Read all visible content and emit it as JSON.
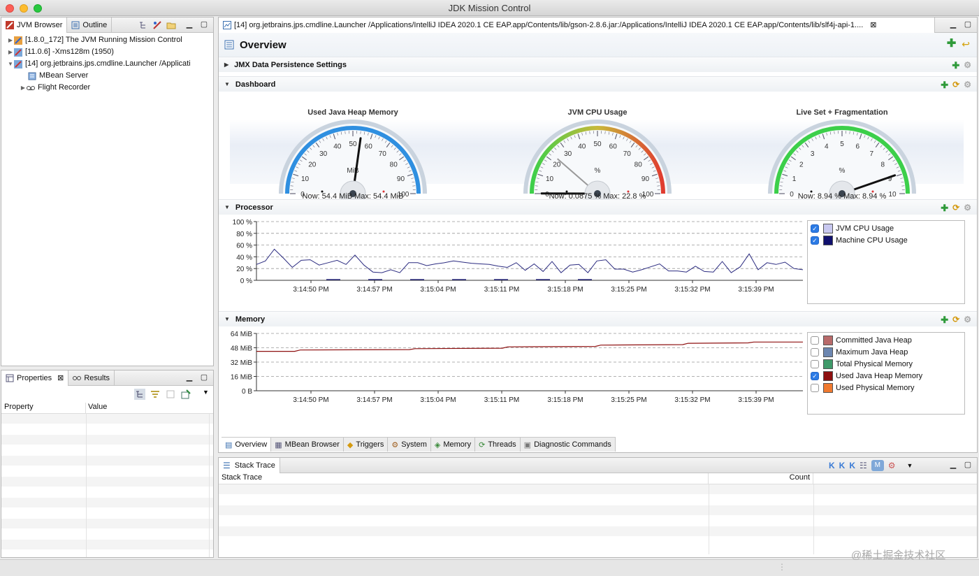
{
  "window": {
    "title": "JDK Mission Control"
  },
  "left_top": {
    "tabs": [
      {
        "label": "JVM Browser"
      },
      {
        "label": "Outline"
      }
    ],
    "tree": [
      {
        "label": "[1.8.0_172] The JVM Running Mission Control"
      },
      {
        "label": "[11.0.6] -Xms128m (1950)"
      },
      {
        "label": "[14] org.jetbrains.jps.cmdline.Launcher /Applicati"
      },
      {
        "label": "MBean Server"
      },
      {
        "label": "Flight Recorder"
      }
    ]
  },
  "left_bottom": {
    "tabs": [
      {
        "label": "Properties"
      },
      {
        "label": "Results"
      }
    ],
    "columns": [
      "Property",
      "Value"
    ]
  },
  "editor": {
    "tab_label": "[14] org.jetbrains.jps.cmdline.Launcher /Applications/IntelliJ IDEA 2020.1 CE EAP.app/Contents/lib/gson-2.8.6.jar:/Applications/IntelliJ IDEA 2020.1 CE EAP.app/Contents/lib/slf4j-api-1....",
    "page_title": "Overview",
    "sections": {
      "jmx": "JMX Data Persistence Settings",
      "dashboard": "Dashboard",
      "processor": "Processor",
      "memory": "Memory"
    },
    "gauges": [
      {
        "title": "Used Java Heap Memory",
        "unit": "MiB",
        "ticks": [
          "0",
          "10",
          "20",
          "30",
          "40",
          "50",
          "60",
          "70",
          "80",
          "90",
          "100"
        ],
        "needle": 54.4,
        "max": 100,
        "readout": "Now: 54.4 MiB   Max: 54.4 MiB",
        "arc": "blue"
      },
      {
        "title": "JVM CPU Usage",
        "unit": "%",
        "ticks": [
          "0",
          "10",
          "20",
          "30",
          "40",
          "50",
          "60",
          "70",
          "80",
          "90",
          "100"
        ],
        "needle": 0.0875,
        "max_needle": 22.8,
        "max": 100,
        "readout": "Now: 0.0875 %   Max: 22.8 %",
        "arc": "gyr"
      },
      {
        "title": "Live Set + Fragmentation",
        "unit": "%",
        "ticks": [
          "0",
          "1",
          "2",
          "3",
          "4",
          "5",
          "6",
          "7",
          "8",
          "9",
          "10"
        ],
        "needle": 8.94,
        "max": 10,
        "readout": "Now: 8.94 %   Max: 8.94 %",
        "arc": "green"
      }
    ],
    "processor_chart": {
      "y_ticks": [
        "100 %",
        "80 %",
        "60 %",
        "40 %",
        "20 %",
        "0 %"
      ],
      "x_ticks": [
        "3:14:50 PM",
        "3:14:57 PM",
        "3:15:04 PM",
        "3:15:11 PM",
        "3:15:18 PM",
        "3:15:25 PM",
        "3:15:32 PM",
        "3:15:39 PM"
      ],
      "legend": [
        {
          "label": "JVM CPU Usage",
          "checked": true,
          "color": "#c8c8f0"
        },
        {
          "label": "Machine CPU Usage",
          "checked": true,
          "color": "#10106e"
        }
      ]
    },
    "memory_chart": {
      "y_ticks": [
        "64 MiB",
        "48 MiB",
        "32 MiB",
        "16 MiB",
        "0 B"
      ],
      "x_ticks": [
        "3:14:50 PM",
        "3:14:57 PM",
        "3:15:04 PM",
        "3:15:11 PM",
        "3:15:18 PM",
        "3:15:25 PM",
        "3:15:32 PM",
        "3:15:39 PM"
      ],
      "legend": [
        {
          "label": "Committed Java Heap",
          "checked": false,
          "color": "#b86a6a"
        },
        {
          "label": "Maximum Java Heap",
          "checked": false,
          "color": "#6c86b0"
        },
        {
          "label": "Total Physical Memory",
          "checked": false,
          "color": "#3f9a6a"
        },
        {
          "label": "Used Java Heap Memory",
          "checked": true,
          "color": "#8e1010"
        },
        {
          "label": "Used Physical Memory",
          "checked": false,
          "color": "#f07a30"
        }
      ]
    },
    "bottom_tabs": [
      "Overview",
      "MBean Browser",
      "Triggers",
      "System",
      "Memory",
      "Threads",
      "Diagnostic Commands"
    ]
  },
  "stack_trace": {
    "tab_label": "Stack Trace",
    "columns": [
      "Stack Trace",
      "Count"
    ]
  },
  "watermark": "@稀土掘金技术社区"
}
